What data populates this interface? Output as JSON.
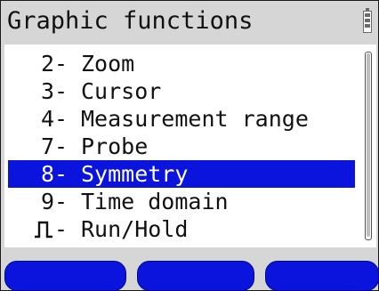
{
  "header": {
    "title": "Graphic functions",
    "battery_icon": "battery-icon"
  },
  "menu": {
    "items": [
      {
        "key": "2",
        "separator": "-",
        "label": "Zoom",
        "selected": false
      },
      {
        "key": "3",
        "separator": "-",
        "label": "Cursor",
        "selected": false
      },
      {
        "key": "4",
        "separator": "-",
        "label": "Measurement range",
        "selected": false
      },
      {
        "key": "7",
        "separator": "-",
        "label": "Probe",
        "selected": false
      },
      {
        "key": "8",
        "separator": "-",
        "label": "Symmetry",
        "selected": true
      },
      {
        "key": "9",
        "separator": "-",
        "label": "Time domain",
        "selected": false
      },
      {
        "key_icon": "pulse-key-icon",
        "separator": "-",
        "label": "Run/Hold",
        "selected": false
      }
    ]
  },
  "softkeys": {
    "count": 3,
    "color": "#0a14dc"
  },
  "colors": {
    "selection": "#0a14dc",
    "header_background": "#d6d6d6",
    "panel_background": "#ffffff"
  }
}
